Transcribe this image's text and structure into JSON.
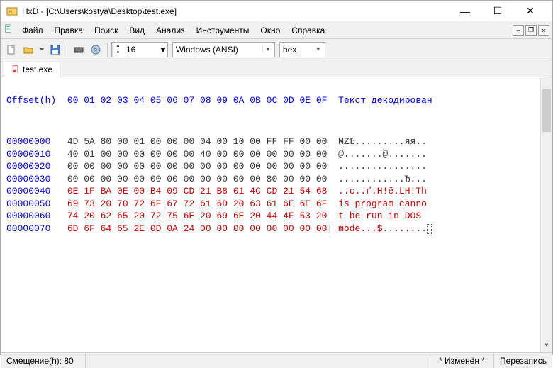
{
  "window": {
    "title": "HxD - [C:\\Users\\kostya\\Desktop\\test.exe]"
  },
  "menu": {
    "items": [
      "Файл",
      "Правка",
      "Поиск",
      "Вид",
      "Анализ",
      "Инструменты",
      "Окно",
      "Справка"
    ]
  },
  "toolbar": {
    "bytes_per_row": "16",
    "encoding": "Windows (ANSI)",
    "number_base": "hex"
  },
  "tab": {
    "label": "test.exe"
  },
  "hex": {
    "header_offset": "Offset(h)",
    "header_cols": "00 01 02 03 04 05 06 07 08 09 0A 0B 0C 0D 0E 0F",
    "header_ascii": "Текст декодирован",
    "rows": [
      {
        "offset": "00000000",
        "bytes": "4D 5A 80 00 01 00 00 00 04 00 10 00 FF FF 00 00",
        "ascii": "MZЂ.........яя..",
        "mod": false
      },
      {
        "offset": "00000010",
        "bytes": "40 01 00 00 00 00 00 00 40 00 00 00 00 00 00 00",
        "ascii": "@.......@.......",
        "mod": false
      },
      {
        "offset": "00000020",
        "bytes": "00 00 00 00 00 00 00 00 00 00 00 00 00 00 00 00",
        "ascii": "................",
        "mod": false
      },
      {
        "offset": "00000030",
        "bytes": "00 00 00 00 00 00 00 00 00 00 00 00 80 00 00 00",
        "ascii": "............Ђ...",
        "mod": false
      },
      {
        "offset": "00000040",
        "bytes": "0E 1F BA 0E 00 B4 09 CD 21 B8 01 4C CD 21 54 68",
        "ascii": "..є..ґ.Н!ё.LН!Th",
        "mod": true
      },
      {
        "offset": "00000050",
        "bytes": "69 73 20 70 72 6F 67 72 61 6D 20 63 61 6E 6E 6F",
        "ascii": "is program canno",
        "mod": true
      },
      {
        "offset": "00000060",
        "bytes": "74 20 62 65 20 72 75 6E 20 69 6E 20 44 4F 53 20",
        "ascii": "t be run in DOS ",
        "mod": true
      },
      {
        "offset": "00000070",
        "bytes": "6D 6F 64 65 2E 0D 0A 24 00 00 00 00 00 00 00 00",
        "ascii": "mode...$........",
        "mod": true
      }
    ],
    "cursor_row": 7
  },
  "status": {
    "offset_label": "Смещение(h): 80",
    "modified": "* Изменён *",
    "overwrite": "Перезапись"
  }
}
